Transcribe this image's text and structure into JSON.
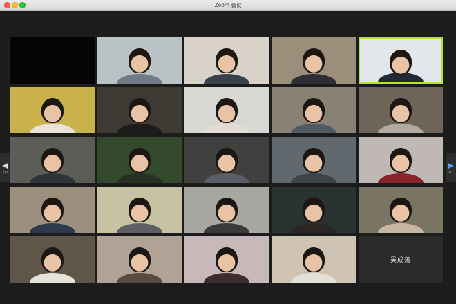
{
  "window": {
    "title": "Zoom 会议"
  },
  "pager": {
    "prev_label": "1/2",
    "next_label": "2/2"
  },
  "gallery": {
    "tiles": [
      {
        "video": false,
        "name": "",
        "bg": "#050505"
      },
      {
        "video": true,
        "bg": "#b9c3c6",
        "shirt": "#6f7b86",
        "name": ""
      },
      {
        "video": true,
        "bg": "#d8d2c8",
        "shirt": "#3a4250",
        "name": ""
      },
      {
        "video": true,
        "bg": "#9b8f7b",
        "shirt": "#2f2f36",
        "name": ""
      },
      {
        "video": true,
        "bg": "#e3e6ea",
        "shirt": "#222a3a",
        "name": "",
        "active": true
      },
      {
        "video": true,
        "bg": "#c9b14c",
        "shirt": "#e9e3d8",
        "name": ""
      },
      {
        "video": true,
        "bg": "#3f3a33",
        "shirt": "#1f1d1c",
        "name": ""
      },
      {
        "video": true,
        "bg": "#d7d8d3",
        "shirt": "#e2dcd3",
        "name": ""
      },
      {
        "video": true,
        "bg": "#8a8176",
        "shirt": "#4f5a63",
        "name": ""
      },
      {
        "video": true,
        "bg": "#6e6457",
        "shirt": "#b2aaa0",
        "name": ""
      },
      {
        "video": true,
        "bg": "#5b5e57",
        "shirt": "#2f3436",
        "name": ""
      },
      {
        "video": true,
        "bg": "#344a2c",
        "shirt": "#263123",
        "name": ""
      },
      {
        "video": true,
        "bg": "#40403e",
        "shirt": "#5a5e66",
        "name": ""
      },
      {
        "video": true,
        "bg": "#61686e",
        "shirt": "#3e4347",
        "name": ""
      },
      {
        "video": true,
        "bg": "#bfb8b5",
        "shirt": "#8b2428",
        "name": ""
      },
      {
        "video": true,
        "bg": "#9c8f7e",
        "shirt": "#2d3a4c",
        "name": ""
      },
      {
        "video": true,
        "bg": "#c7c2a3",
        "shirt": "#5e6065",
        "name": ""
      },
      {
        "video": true,
        "bg": "#a8a7a2",
        "shirt": "#3a3b3d",
        "name": ""
      },
      {
        "video": true,
        "bg": "#293331",
        "shirt": "#2a2724",
        "name": ""
      },
      {
        "video": true,
        "bg": "#7a7462",
        "shirt": "#c8b6a4",
        "name": ""
      },
      {
        "video": true,
        "bg": "#5f5649",
        "shirt": "#e6e2dc",
        "name": ""
      },
      {
        "video": true,
        "bg": "#b0a395",
        "shirt": "#5a4a3f",
        "name": ""
      },
      {
        "video": true,
        "bg": "#c8b8ba",
        "shirt": "#3b2e2c",
        "name": ""
      },
      {
        "video": true,
        "bg": "#cfc3b3",
        "shirt": "#e3e0da",
        "name": ""
      },
      {
        "video": false,
        "name": "吴成蔫",
        "bg": "#2b2b2b"
      }
    ]
  }
}
